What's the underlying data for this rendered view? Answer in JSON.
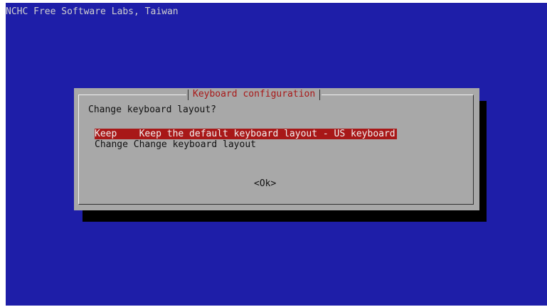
{
  "backtitle": "NCHC Free Software Labs, Taiwan",
  "dialog": {
    "title": "Keyboard configuration",
    "prompt": "Change keyboard layout?",
    "items": [
      {
        "tag": "Keep",
        "description": "Keep the default keyboard layout - US keyboard",
        "selected": true
      },
      {
        "tag": "Change",
        "description": "Change keyboard layout",
        "selected": false
      }
    ],
    "ok_label": "<Ok>"
  },
  "colors": {
    "background": "#1e1ea8",
    "dialog": "#a8a8a8",
    "title": "#a81818",
    "selection": "#a81818",
    "shadow": "#000000"
  }
}
